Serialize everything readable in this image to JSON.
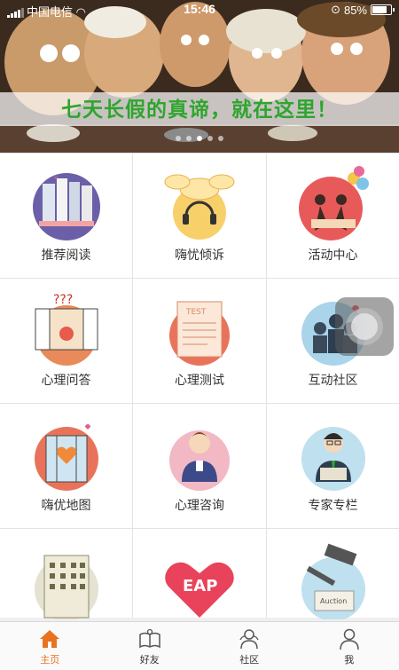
{
  "status_bar": {
    "carrier": "中国电信",
    "time": "15:46",
    "battery": "85%"
  },
  "banner": {
    "caption": "七天长假的真谛，就在这里！",
    "page_count": 5,
    "active_page": 3
  },
  "grid": [
    {
      "label": "推荐阅读",
      "icon": "books-icon"
    },
    {
      "label": "嗨忧倾诉",
      "icon": "headset-chat-icon"
    },
    {
      "label": "活动中心",
      "icon": "dancing-balloons-icon"
    },
    {
      "label": "心理问答",
      "icon": "window-question-icon"
    },
    {
      "label": "心理测试",
      "icon": "test-paper-icon"
    },
    {
      "label": "互动社区",
      "icon": "people-community-icon"
    },
    {
      "label": "嗨优地图",
      "icon": "heart-door-map-icon"
    },
    {
      "label": "心理咨询",
      "icon": "counselor-icon"
    },
    {
      "label": "专家专栏",
      "icon": "expert-icon"
    },
    {
      "label": "",
      "icon": "building-icon"
    },
    {
      "label": "",
      "icon": "eap-heart-icon"
    },
    {
      "label": "",
      "icon": "auction-gavel-icon"
    }
  ],
  "tabbar": {
    "items": [
      {
        "label": "主页",
        "icon": "home-icon",
        "active": true
      },
      {
        "label": "好友",
        "icon": "friends-book-icon",
        "active": false
      },
      {
        "label": "社区",
        "icon": "community-icon",
        "active": false
      },
      {
        "label": "我",
        "icon": "person-icon",
        "active": false
      }
    ],
    "active_color": "#e8731e"
  },
  "colors": {
    "caption_green": "#2ea52e",
    "accent_orange": "#e8731e"
  }
}
